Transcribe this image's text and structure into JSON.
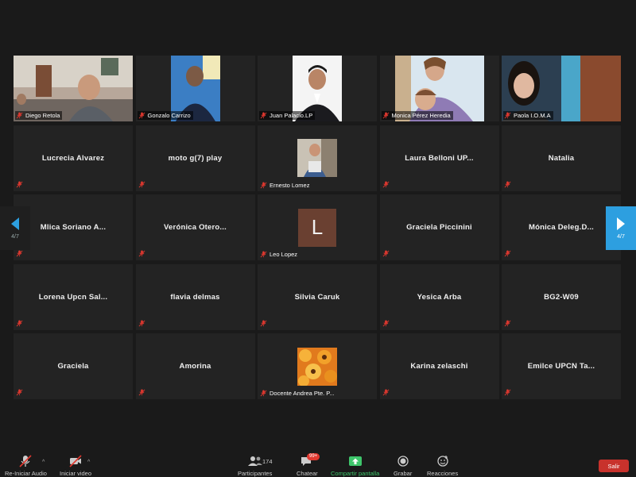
{
  "participants": [
    {
      "name": "Diego Retola",
      "type": "video"
    },
    {
      "name": "Gonzalo Carrizo",
      "type": "video"
    },
    {
      "name": "Juan Palacio.LP",
      "type": "video"
    },
    {
      "name": "Monica Pérez Heredia",
      "type": "video"
    },
    {
      "name": "Paola I.O.M.A",
      "type": "video"
    },
    {
      "name": "Lucrecia Alvarez",
      "type": "name"
    },
    {
      "name": "moto g(7) play",
      "type": "name"
    },
    {
      "name": "Ernesto Lomez",
      "type": "photo"
    },
    {
      "name": "Laura Belloni UP...",
      "type": "name"
    },
    {
      "name": "Natalia",
      "type": "name"
    },
    {
      "name": "Mlica Soriano A...",
      "type": "name"
    },
    {
      "name": "Verónica Otero...",
      "type": "name"
    },
    {
      "name": "Leo Lopez",
      "type": "letter",
      "letter": "L"
    },
    {
      "name": "Graciela Piccinini",
      "type": "name"
    },
    {
      "name": "Mónica Deleg.D...",
      "type": "name"
    },
    {
      "name": "Lorena Upcn Sal...",
      "type": "name"
    },
    {
      "name": "flavia delmas",
      "type": "name"
    },
    {
      "name": "Silvia Caruk",
      "type": "name"
    },
    {
      "name": "Yesica Arba",
      "type": "name"
    },
    {
      "name": "BG2-W09",
      "type": "name"
    },
    {
      "name": "Graciela",
      "type": "name"
    },
    {
      "name": "Amorina",
      "type": "name"
    },
    {
      "name": "Docente Andrea Pte. P...",
      "type": "photo"
    },
    {
      "name": "Karina zelaschi",
      "type": "name"
    },
    {
      "name": "Emilce UPCN Ta...",
      "type": "name"
    }
  ],
  "pagination": {
    "left": "4/7",
    "right": "4/7"
  },
  "toolbar": {
    "audio": "Re-Iniciar Audio",
    "video": "Iniciar video",
    "participants": "Participantes",
    "participant_count": "174",
    "chat": "Chatear",
    "chat_badge": "99+",
    "share": "Compartir pantalla",
    "record": "Grabar",
    "reactions": "Reacciones",
    "leave": "Salir"
  },
  "colors": {
    "background": "#1a1a1a",
    "tile": "#232323",
    "accent": "#2d9fe0",
    "share": "#3ec56b",
    "leave": "#c8322c",
    "mic_off": "#e0382f"
  }
}
